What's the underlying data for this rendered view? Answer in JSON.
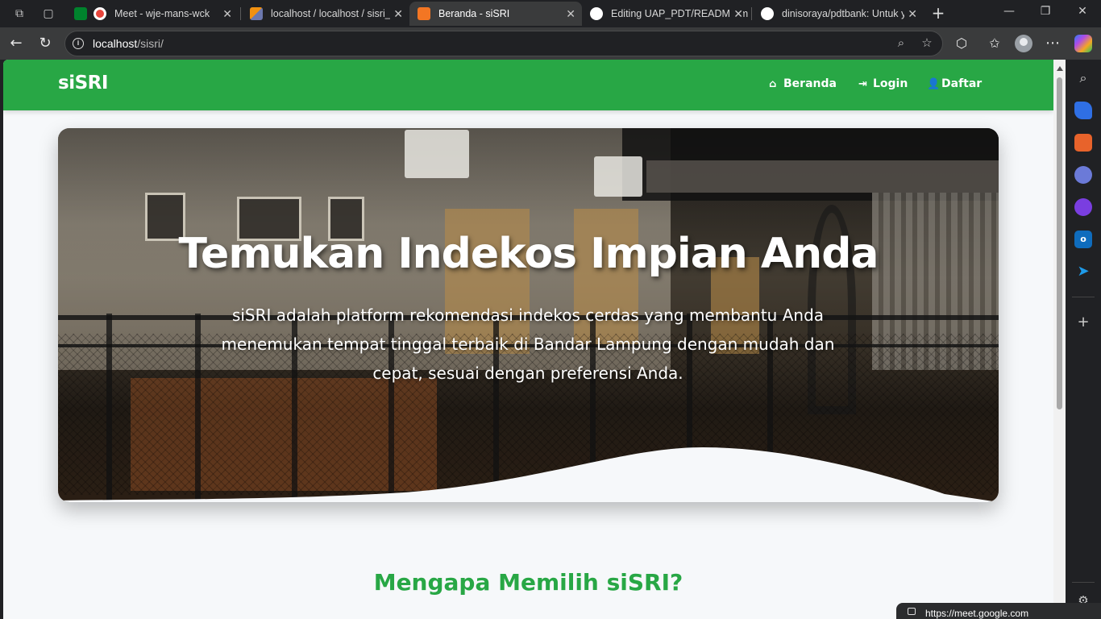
{
  "browser": {
    "tabs": [
      {
        "label": "Meet - wje-mans-wck",
        "favicon": "google-meet-icon",
        "color": "#e8453c",
        "active": false
      },
      {
        "label": "localhost / localhost / sisri_d",
        "favicon": "phpmyadmin-icon",
        "color": "#f29111",
        "active": false
      },
      {
        "label": "Beranda - siSRI",
        "favicon": "xampp-icon",
        "color": "#f37623",
        "active": true
      },
      {
        "label": "Editing UAP_PDT/README.m",
        "favicon": "github-icon",
        "color": "#ffffff",
        "active": false
      },
      {
        "label": "dinisoraya/pdtbank: Untuk y",
        "favicon": "github-icon",
        "color": "#ffffff",
        "active": false
      }
    ],
    "url_host": "localhost",
    "url_path": "/sisri/",
    "toast_url": "https://meet.google.com"
  },
  "site": {
    "brand": "siSRI",
    "brand_color": "#28a745",
    "nav": [
      {
        "label": "Beranda",
        "icon": "home-icon"
      },
      {
        "label": "Login",
        "icon": "login-icon"
      },
      {
        "label": "Daftar",
        "icon": "user-plus-icon"
      }
    ]
  },
  "hero": {
    "title": "Temukan Indekos Impian Anda",
    "subtitle": "siSRI adalah platform rekomendasi indekos cerdas yang membantu Anda menemukan tempat tinggal terbaik di Bandar Lampung dengan mudah dan cepat, sesuai dengan preferensi Anda."
  },
  "section": {
    "title": "Mengapa Memilih siSRI?"
  }
}
